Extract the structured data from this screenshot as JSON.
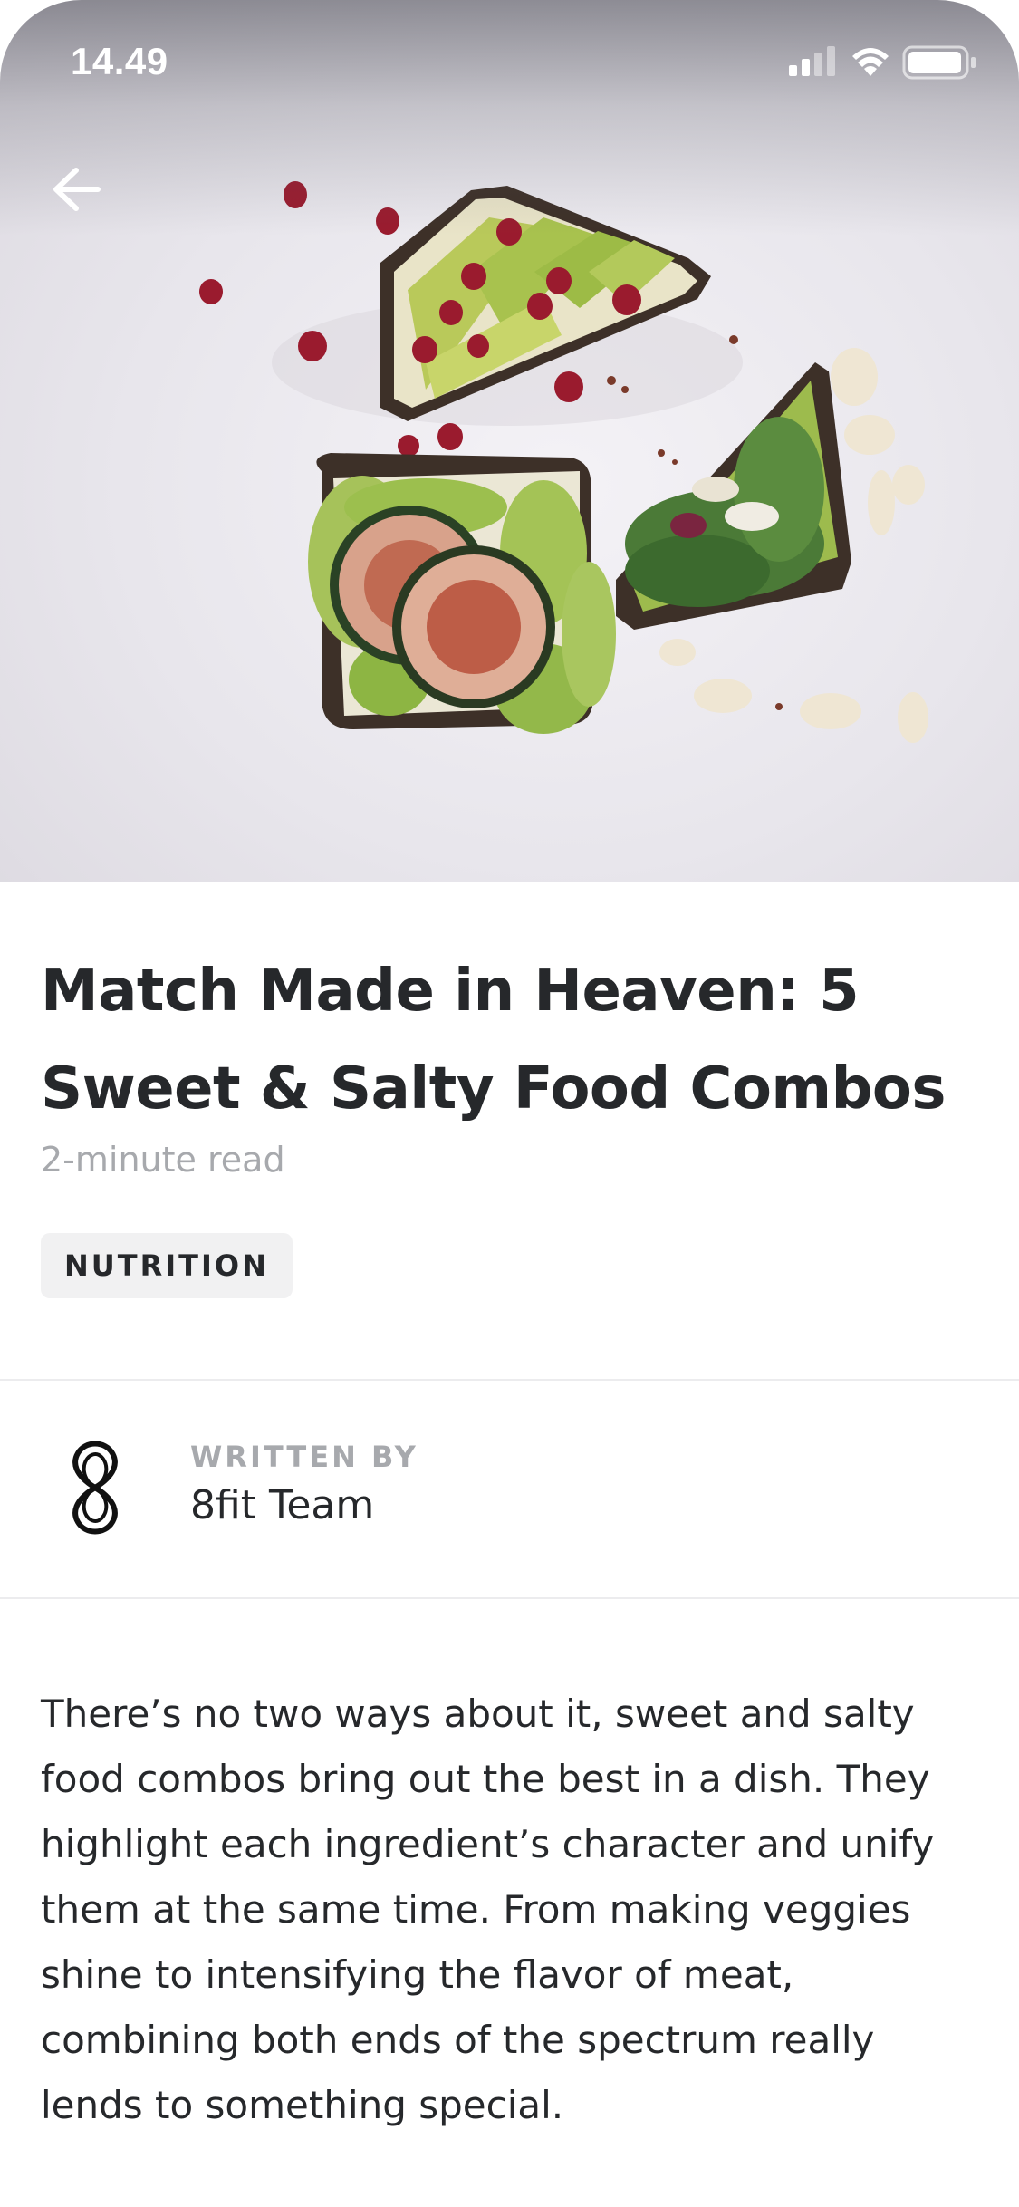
{
  "status_bar": {
    "time": "14.49",
    "icons": [
      "signal-icon",
      "wifi-icon",
      "battery-icon"
    ]
  },
  "navigation": {
    "back_icon": "arrow-left-icon"
  },
  "hero": {
    "image_description_icon": "avocado-toast-photo"
  },
  "article": {
    "title": "Match Made in Heaven: 5 Sweet & Salty Food Combos",
    "read_time": "2-minute read",
    "tag": "NUTRITION"
  },
  "author": {
    "label": "WRITTEN BY",
    "name": "8fit Team",
    "logo_icon": "8fit-logo-icon"
  },
  "body": {
    "paragraph_1": "There’s no two ways about it, sweet and salty food combos bring out the best in a dish. They highlight each ingredient’s character and unify them at the same time. From making veggies shine to intensifying the flavor of meat, combining both ends of the spectrum really lends to something special."
  },
  "colors": {
    "text_primary": "#26282b",
    "text_secondary": "#a7a9ad",
    "tag_background": "#f1f1f2",
    "divider": "#ececee"
  }
}
